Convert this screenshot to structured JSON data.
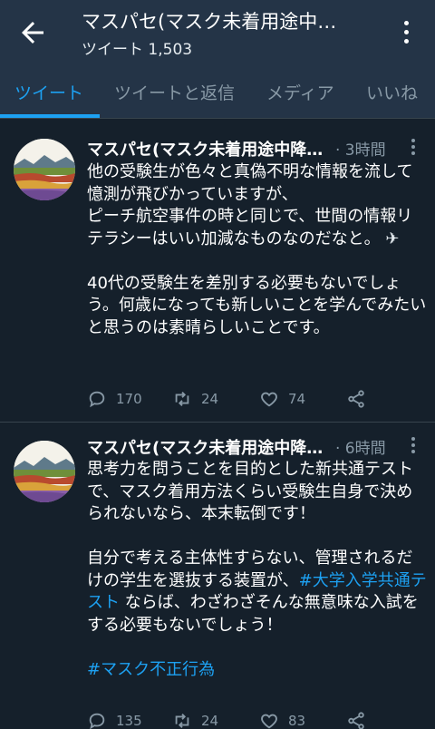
{
  "header": {
    "title": "マスパセ(マスク未着用途中…",
    "tweet_count": "ツイート 1,503"
  },
  "tabs": [
    {
      "label": "ツイート",
      "active": true
    },
    {
      "label": "ツイートと返信",
      "active": false
    },
    {
      "label": "メディア",
      "active": false
    },
    {
      "label": "いいね",
      "active": false
    }
  ],
  "tweets": [
    {
      "name": "マスパセ(マスク未着用途中降…",
      "time": "· 3時間",
      "text_1": "他の受験生が色々と真偽不明な情報を流して憶測が飛びかっていますが、\nピーチ航空事件の時と同じで、世間の情報リテラシーはいい加減なものなのだなと。",
      "emoji": "✈",
      "text_2": "40代の受験生を差別する必要もないでしょう。何歳になっても新しいことを学んでみたいと思うのは素晴らしいことです。",
      "replies": "170",
      "retweets": "24",
      "likes": "74"
    },
    {
      "name": "マスパセ(マスク未着用途中降…",
      "time": "· 6時間",
      "text_1": "思考力を問うことを目的とした新共通テストで、マスク着用方法くらい受験生自身で決められないなら、本末転倒です！",
      "text_2a": "自分で考える主体性すらない、管理されるだけの学生を選抜する装置が、",
      "hashtag_1": "#大学入学共通テスト",
      "text_2b": " ならば、わざわざそんな無意味な入試をする必要もないでしょう！",
      "hashtag_2": "#マスク不正行為",
      "replies": "135",
      "retweets": "24",
      "likes": "83"
    }
  ],
  "colors": {
    "background": "#15202b",
    "header": "#243447",
    "accent": "#1da1f2",
    "muted": "#8899a6"
  }
}
